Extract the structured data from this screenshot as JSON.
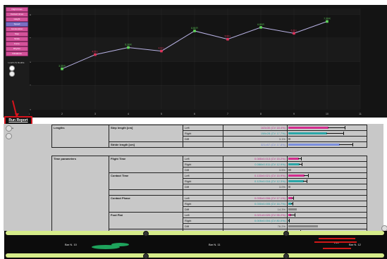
{
  "sidebar": {
    "buttons": [
      "Flight times",
      "Contact times",
      "Height",
      "Speed",
      "Acceleration",
      "Step",
      "Stride",
      "Force",
      "Rhythm",
      "Imbalance"
    ],
    "selected_index": 3,
    "option_label": "Lunch (?) Double",
    "radio_selected": 0
  },
  "run_report": "Run Report",
  "report_side_label": "Vistas",
  "chart_data": {
    "type": "line",
    "x": [
      2,
      3,
      4,
      5,
      6,
      7,
      8,
      9,
      10
    ],
    "y": [
      3.4,
      4.6,
      5.2,
      4.9,
      6.6,
      5.9,
      6.9,
      6.4,
      7.4
    ],
    "point_labels": [
      "3.39 R",
      "4.56 L",
      "5.18 R",
      "4.92 L",
      "6.64 R",
      "5.90 L",
      "6.89 R",
      "6.39 L",
      "7.39 R"
    ],
    "point_colors": [
      "#5fd65a",
      "#e0335a",
      "#5fd65a",
      "#e0335a",
      "#5fd65a",
      "#e0335a",
      "#5fd65a",
      "#e0335a",
      "#5fd65a"
    ],
    "xticks": [
      "1",
      "2",
      "3",
      "4",
      "5",
      "6",
      "7",
      "8",
      "9",
      "10",
      "11"
    ],
    "yticks": [
      "0",
      "2",
      "4",
      "6",
      "8"
    ],
    "xlim": [
      1,
      11
    ],
    "ylim": [
      0,
      8.5
    ],
    "line_color": "#b9b3e6",
    "grid": true,
    "xlabel": "",
    "ylabel": ""
  },
  "report": {
    "sections": [
      {
        "category": "Lengths",
        "params": [
          {
            "name": "Step length [cm]",
            "rows": [
              {
                "side": "Left",
                "value": "163±30  (CV 18.4%)",
                "value_color": "#c02c89",
                "bar": 0.55,
                "err": 0.78,
                "bar_color": "#d42c8e"
              },
              {
                "side": "Right",
                "value": "158±28  (CV 17.7%)",
                "value_color": "#1e9ba0",
                "bar": 0.53,
                "err": 0.76,
                "bar_color": "#2aa7a8"
              },
              {
                "side": "Diff",
                "value": "3.1%",
                "value_color": "#444444",
                "bar": 0.03,
                "err": 0,
                "bar_color": "#888888"
              }
            ]
          },
          {
            "name": "Stride length [cm]",
            "rows": [
              {
                "side": "",
                "value": "321±57  (CV 17.8%)",
                "value_color": "#6b7fd6",
                "bar": 0.7,
                "err": 0.88,
                "bar_color": "#7b8fe0"
              }
            ]
          }
        ]
      },
      {
        "category": "Time parameters",
        "params": [
          {
            "name": "Flight Time",
            "rows": [
              {
                "side": "Left",
                "value": "0.085±0.013  (CV 15.2%)",
                "value_color": "#c02c89",
                "bar": 0.14,
                "err": 0.18,
                "bar_color": "#d42c8e"
              },
              {
                "side": "Right",
                "value": "0.088±0.011  (CV 12.9%)",
                "value_color": "#1e9ba0",
                "bar": 0.15,
                "err": 0.19,
                "bar_color": "#2aa7a8"
              },
              {
                "side": "Diff",
                "value": "3.5%",
                "value_color": "#444444",
                "bar": 0.04,
                "err": 0,
                "bar_color": "#888888"
              }
            ]
          },
          {
            "name": "Contact Time",
            "rows": [
              {
                "side": "Left",
                "value": "0.133±0.021  (CV 15.9%)",
                "value_color": "#c02c89",
                "bar": 0.22,
                "err": 0.28,
                "bar_color": "#d42c8e"
              },
              {
                "side": "Right",
                "value": "0.129±0.016  (CV 12.3%)",
                "value_color": "#1e9ba0",
                "bar": 0.21,
                "err": 0.26,
                "bar_color": "#2aa7a8"
              },
              {
                "side": "Diff",
                "value": "3.0%",
                "value_color": "#444444",
                "bar": 0.03,
                "err": 0,
                "bar_color": "#888888"
              }
            ]
          },
          {
            "name": "",
            "rows": [
              {
                "side": "",
                "value": "",
                "value_color": "#444444",
                "bar": 0,
                "err": 0,
                "bar_color": "#888888"
              }
            ]
          },
          {
            "name": "Contact Phase",
            "rows": [
              {
                "side": "Left",
                "value": "0.035±0.006  (CV 17.1%)",
                "value_color": "#c02c89",
                "bar": 0.06,
                "err": 0.08,
                "bar_color": "#d42c8e"
              },
              {
                "side": "Right",
                "value": "0.030±0.005  (CV 16.7%)",
                "value_color": "#1e9ba0",
                "bar": 0.05,
                "err": 0.07,
                "bar_color": "#2aa7a8"
              },
              {
                "side": "Diff",
                "value": "14.3%",
                "value_color": "#444444",
                "bar": 0.12,
                "err": 0,
                "bar_color": "#888888"
              }
            ]
          },
          {
            "name": "Foot Flat",
            "rows": [
              {
                "side": "Left",
                "value": "0.021±0.020  (CV 95.2%)",
                "value_color": "#c02c89",
                "bar": 0.04,
                "err": 0.1,
                "bar_color": "#d42c8e"
              },
              {
                "side": "Right",
                "value": "0.005±0.004  (CV 80.0%)",
                "value_color": "#1e9ba0",
                "bar": 0.01,
                "err": 0.02,
                "bar_color": "#2aa7a8"
              },
              {
                "side": "Diff",
                "value": "76.2%",
                "value_color": "#444444",
                "bar": 0.4,
                "err": 0,
                "bar_color": "#888888"
              }
            ]
          },
          {
            "name": "Propulsive Phase",
            "rows": [
              {
                "side": "Left",
                "value": "0.077±0.020  (CV 26.0%)",
                "value_color": "#c02c89",
                "bar": 0.13,
                "err": 0.17,
                "bar_color": "#d42c8e"
              },
              {
                "side": "Right",
                "value": "0.094±0.017  (CV 18.1%)",
                "value_color": "#1e9ba0",
                "bar": 0.16,
                "err": 0.2,
                "bar_color": "#2aa7a8"
              },
              {
                "side": "Diff",
                "value": "22.1%",
                "value_color": "#444444",
                "bar": 0.12,
                "err": 0,
                "bar_color": "#888888"
              }
            ]
          }
        ]
      }
    ]
  },
  "timeline": {
    "labels": [
      "Bar N. 10",
      "Bar N. 11",
      "Bar N. 12"
    ],
    "highlight_label": "L10",
    "colors": {
      "track": "#d6ec8a",
      "left": "#1ea35c",
      "right": "#d01818"
    }
  }
}
